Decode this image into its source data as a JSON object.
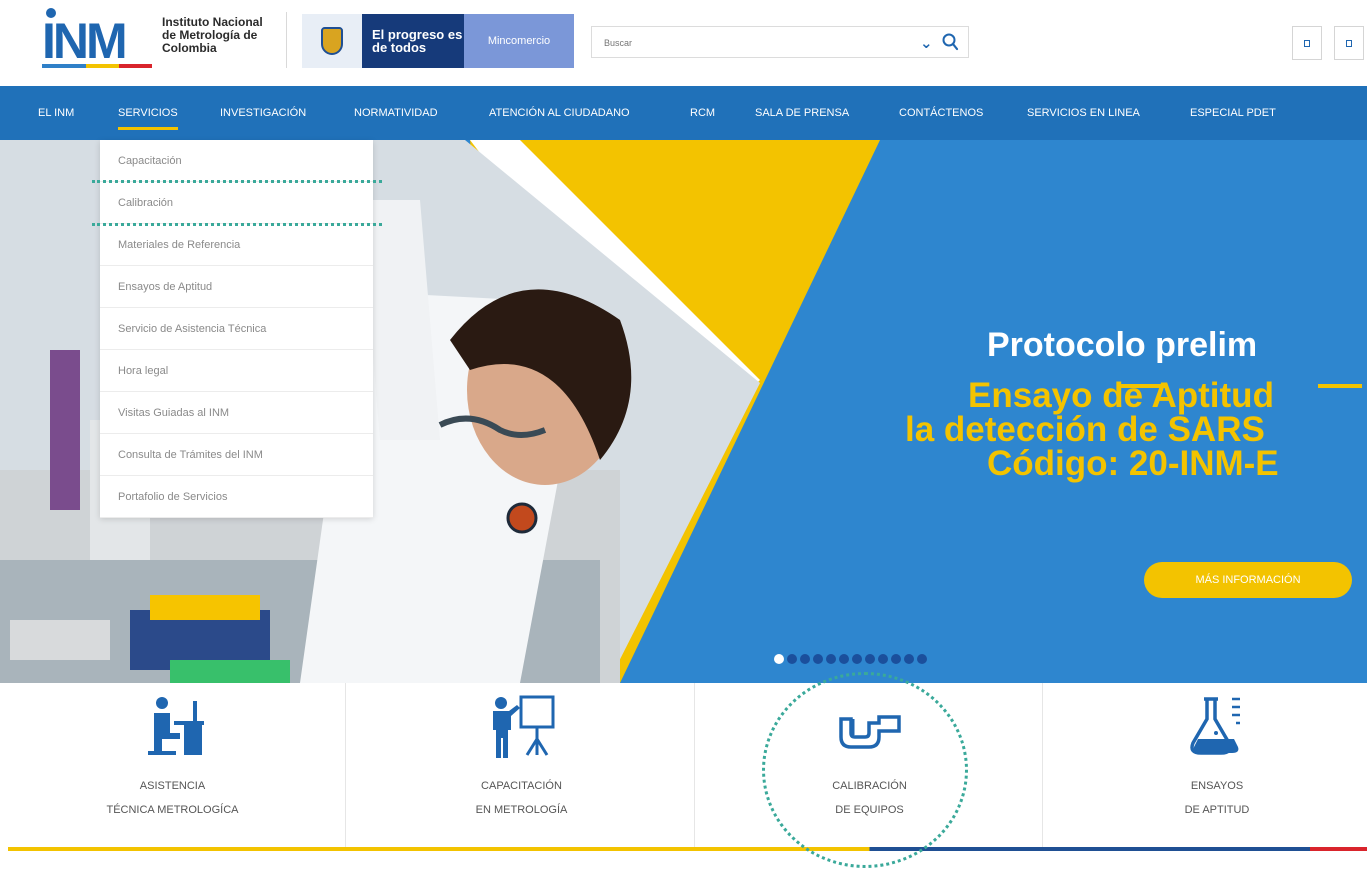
{
  "header": {
    "logo_text": "INM",
    "logo_name": "Instituto Nacional de Metrología de Colombia",
    "gov_progreso": "El progreso es de todos",
    "gov_mincomercio": "Mincomercio",
    "search_placeholder": "Buscar"
  },
  "nav": {
    "items": [
      "EL INM",
      "SERVICIOS",
      "INVESTIGACIÓN",
      "NORMATIVIDAD",
      "ATENCIÓN AL CIUDADANO",
      "RCM",
      "SALA DE PRENSA",
      "CONTÁCTENOS",
      "SERVICIOS EN LINEA",
      "ESPECIAL PDET"
    ],
    "active": "SERVICIOS"
  },
  "dropdown": {
    "items": [
      "Capacitación",
      "Calibración",
      "Materiales de Referencia",
      "Ensayos de Aptitud",
      "Servicio de Asistencia Técnica",
      "Hora legal",
      "Visitas Guiadas al INM",
      "Consulta de Trámites del INM",
      "Portafolio de Servicios"
    ],
    "highlighted": "Calibración"
  },
  "hero": {
    "title": "Protocolo prelim",
    "subtitle_1": "Ensayo de Aptitud",
    "subtitle_2": "la detección de SARS",
    "subtitle_3": "Código: 20-INM-E",
    "button": "MÁS INFORMACIÓN",
    "slide_count": 12,
    "active_slide": 1
  },
  "services": [
    {
      "line1": "ASISTENCIA",
      "line2": "TÉCNICA METROLOGÍCA",
      "icon": "desk-worker-icon"
    },
    {
      "line1": "CAPACITACIÓN",
      "line2": "EN METROLOGÍA",
      "icon": "presenter-board-icon"
    },
    {
      "line1": "CALIBRACIÓN",
      "line2": "DE EQUIPOS",
      "icon": "caliper-icon"
    },
    {
      "line1": "ENSAYOS",
      "line2": "DE APTITUD",
      "icon": "flask-icon"
    }
  ],
  "colors": {
    "nav_blue": "#2071b9",
    "hero_blue": "#2e86cf",
    "accent_yellow": "#f3c300",
    "icon_blue": "#1f66b0",
    "callout_teal": "#3aa99a"
  }
}
